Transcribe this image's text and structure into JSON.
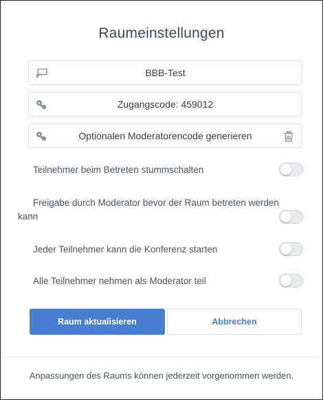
{
  "dialog": {
    "title": "Raumeinstellungen",
    "room_name": {
      "value": "BBB-Test",
      "icon": "presentation-icon"
    },
    "access_code": {
      "value": "Zugangscode: 459012",
      "icon": "keys-icon"
    },
    "moderator_code": {
      "value": "Optionalen Moderatorencode generieren",
      "icon": "keys-icon",
      "action_icon": "trash-icon"
    },
    "options": [
      {
        "label": "Teilnehmer beim Betreten stummschalten",
        "enabled": false
      },
      {
        "label_line1": "Freigabe durch Moderator bevor der Raum betreten werden",
        "label_line2": "kann",
        "enabled": false
      },
      {
        "label": "Jeder Teilnehmer kann die Konferenz starten",
        "enabled": false
      },
      {
        "label": "Alle Teilnehmer nehmen als Moderator teil",
        "enabled": false
      }
    ],
    "buttons": {
      "update": "Raum aktualisieren",
      "cancel": "Abbrechen"
    },
    "footer": "Anpassungen des Raums können jederzeit vorgenommen werden.",
    "colors": {
      "primary": "#467fcf",
      "title": "#3d4a56",
      "text": "#4a5560"
    }
  }
}
